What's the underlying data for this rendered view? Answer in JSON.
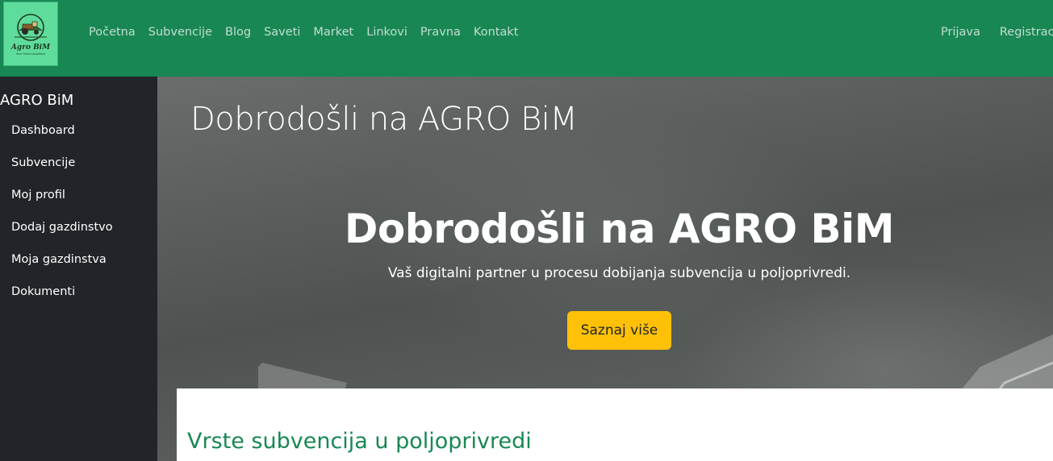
{
  "brand": {
    "logo_text": "Agro BiM",
    "logo_subtext": "Your Smart Assistant"
  },
  "nav": {
    "links": [
      "Početna",
      "Subvencije",
      "Blog",
      "Saveti",
      "Market",
      "Linkovi",
      "Pravna",
      "Kontakt"
    ],
    "login": "Prijava",
    "register": "Registracija"
  },
  "sidebar": {
    "title": "AGRO BiM",
    "items": [
      {
        "label": "Dashboard"
      },
      {
        "label": "Subvencije"
      },
      {
        "label": "Moj profil"
      },
      {
        "label": "Dodaj gazdinstvo"
      },
      {
        "label": "Moja gazdinstva"
      },
      {
        "label": "Dokumenti"
      }
    ]
  },
  "hero": {
    "small_heading": "Dobrodošli na AGRO BiM",
    "big_heading": "Dobrodošli na AGRO BiM",
    "subtitle": "Vaš digitalni partner u procesu dobijanja subvencija u poljoprivredi.",
    "button_label": "Saznaj više"
  },
  "content": {
    "section_title": "Vrste subvencija u poljoprivredi"
  },
  "colors": {
    "navbar": "#198754",
    "sidebar": "#212529",
    "button": "#ffc107",
    "section_title": "#198754"
  }
}
